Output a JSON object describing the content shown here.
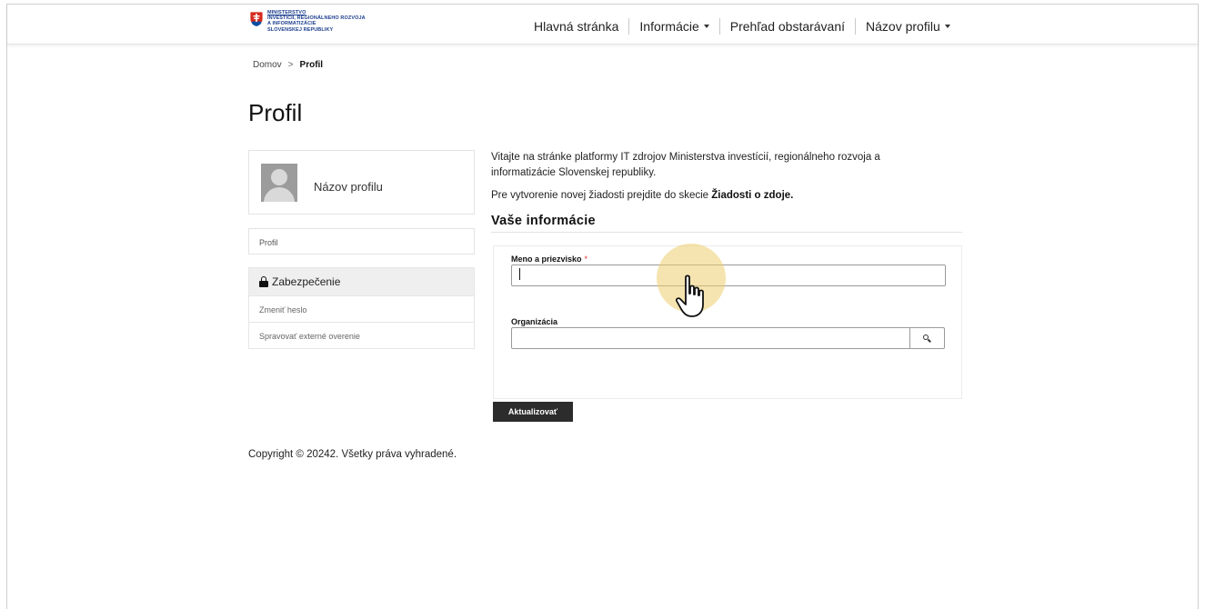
{
  "header": {
    "logo_lines": [
      "MINISTERSTVO",
      "INVESTÍCIÍ, REGIONÁLNEHO ROZVOJA",
      "A INFORMATIZÁCIE",
      "SLOVENSKEJ REPUBLIKY"
    ],
    "nav": [
      {
        "label": "Hlavná stránka",
        "dropdown": false
      },
      {
        "label": "Informácie",
        "dropdown": true
      },
      {
        "label": "Prehľad obstarávaní",
        "dropdown": false
      },
      {
        "label": "Názov profilu",
        "dropdown": true
      }
    ]
  },
  "breadcrumb": {
    "home": "Domov",
    "separator": ">",
    "current": "Profil"
  },
  "page_title": "Profil",
  "sidebar": {
    "profile_name": "Názov profilu",
    "profile_link": "Profil",
    "security_heading": "Zabezpečenie",
    "security_links": [
      "Zmeniť heslo",
      "Spravovať externé overenie"
    ]
  },
  "main": {
    "intro": "Vitajte na stránke platformy IT zdrojov Ministerstva investícií, regionálneho rozvoja a informatizácie Slovenskej republiky.",
    "intro2_prefix": "Pre vytvorenie novej žiadosti prejdite do skecie ",
    "intro2_bold": "Žiadosti o zdoje.",
    "section_title": "Vaše informácie",
    "form": {
      "name_label": "Meno a priezvisko",
      "required_mark": "*",
      "name_value": "",
      "org_label": "Organizácia",
      "org_value": ""
    },
    "update_button": "Aktualizovať"
  },
  "footer": {
    "copyright": "Copyright © 20242. Všetky práva vyhradené."
  },
  "icons": {
    "crest": "slovak-coat-of-arms-icon",
    "lock": "lock-icon",
    "search": "search-icon",
    "avatar": "user-avatar-icon",
    "cursor": "hand-pointer-icon"
  },
  "colors": {
    "logo_blue": "#1d3f8f",
    "button_dark": "#2c2c2c",
    "required_red": "#d33333",
    "cursor_highlight": "#ecCD6e"
  }
}
